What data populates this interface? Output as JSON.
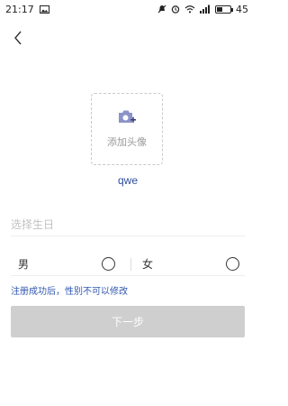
{
  "status_bar": {
    "time": "21:17",
    "battery_level": "45",
    "battery_fraction": 0.45,
    "icons": [
      "image-icon",
      "no-ring-icon",
      "alarm-icon",
      "wifi-icon",
      "signal-icon",
      "battery-icon"
    ]
  },
  "nav": {
    "back_icon": "chevron-left-icon"
  },
  "avatar": {
    "label": "添加头像",
    "icon": "camera-add-icon",
    "accent": "#8c93c9"
  },
  "user": {
    "name": "qwe"
  },
  "birthday": {
    "placeholder": "选择生日"
  },
  "gender": {
    "male_label": "男",
    "female_label": "女",
    "selected": null,
    "hint": "注册成功后，性别不可以修改"
  },
  "next": {
    "label": "下一步",
    "enabled": false
  },
  "colors": {
    "link_blue": "#2f56b0",
    "disabled_button": "#cfcfcf"
  }
}
